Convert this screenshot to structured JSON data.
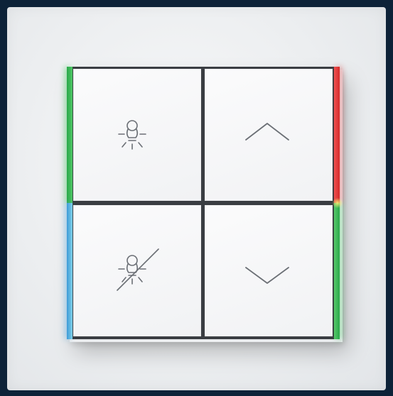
{
  "scene": {
    "subject": "wall-switch-4-key",
    "colors": {
      "background": "#0d2238",
      "plate": "#eceef0",
      "key": "#f5f6f7",
      "icon": "#6b6f75",
      "led_green": "#2aa84a",
      "led_red": "#d42a2a",
      "led_blue": "#5bb5de"
    }
  },
  "keys": [
    {
      "icon": "light-on-icon"
    },
    {
      "icon": "arrow-up-icon"
    },
    {
      "icon": "light-off-icon"
    },
    {
      "icon": "arrow-down-icon"
    }
  ],
  "leds": {
    "left_top": "green",
    "left_bottom": "blue",
    "right_top": "red",
    "right_bottom": "green"
  }
}
